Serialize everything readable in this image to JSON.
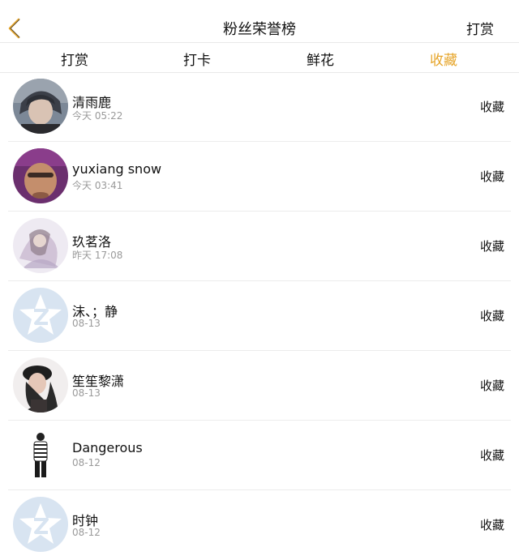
{
  "header": {
    "title": "粉丝荣誉榜",
    "action_label": "打赏",
    "accent_color": "#e6a52a"
  },
  "tabs": [
    {
      "label": "打赏",
      "active": false
    },
    {
      "label": "打卡",
      "active": false
    },
    {
      "label": "鲜花",
      "active": false
    },
    {
      "label": "收藏",
      "active": true
    }
  ],
  "fans": [
    {
      "name": "清雨鹿",
      "time": "今天 05:22",
      "action": "收藏",
      "avatar": "photo-dark-hair"
    },
    {
      "name": "yuxiang snow",
      "time": "今天 03:41",
      "action": "收藏",
      "avatar": "photo-face-purple"
    },
    {
      "name": "玖茗洛",
      "time": "昨天 17:08",
      "action": "收藏",
      "avatar": "photo-illustration"
    },
    {
      "name": "沫、；静",
      "time": "08-13",
      "action": "收藏",
      "avatar": "default-qq-icon"
    },
    {
      "name": "笙笙黎潇",
      "time": "08-13",
      "action": "收藏",
      "avatar": "photo-girl-hat"
    },
    {
      "name": "Dangerous",
      "time": "08-12",
      "action": "收藏",
      "avatar": "photo-striped-figure"
    },
    {
      "name": "时钟",
      "time": "08-12",
      "action": "收藏",
      "avatar": "default-qq-icon"
    }
  ]
}
